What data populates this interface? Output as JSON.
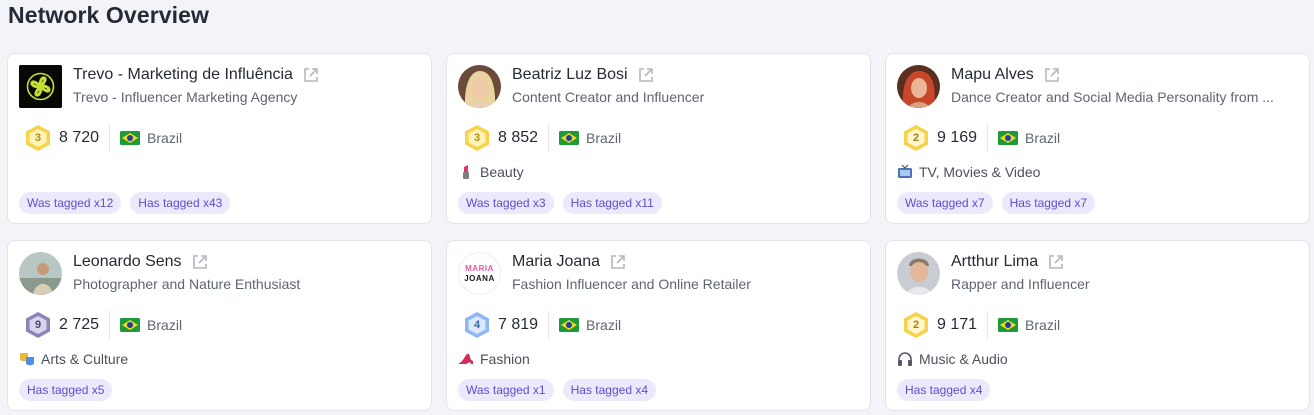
{
  "page": {
    "title": "Network Overview"
  },
  "cards": [
    {
      "name": "Trevo - Marketing de Influência",
      "subtitle": "Trevo - Influencer Marketing Agency",
      "level": "3",
      "followers": "8 720",
      "country": "Brazil",
      "category": "",
      "tags": [
        "Was tagged x12",
        "Has tagged x43"
      ]
    },
    {
      "name": "Beatriz Luz Bosi",
      "subtitle": "Content Creator and Influencer",
      "level": "3",
      "followers": "8 852",
      "country": "Brazil",
      "category": "Beauty",
      "tags": [
        "Was tagged x3",
        "Has tagged x11"
      ]
    },
    {
      "name": "Mapu Alves",
      "subtitle": "Dance Creator and Social Media Personality from ...",
      "level": "2",
      "followers": "9 169",
      "country": "Brazil",
      "category": "TV, Movies & Video",
      "tags": [
        "Was tagged x7",
        "Has tagged x7"
      ]
    },
    {
      "name": "Leonardo Sens",
      "subtitle": "Photographer and Nature Enthusiast",
      "level": "9",
      "followers": "2 725",
      "country": "Brazil",
      "category": "Arts & Culture",
      "tags": [
        "Has tagged x5"
      ]
    },
    {
      "name": "Maria Joana",
      "subtitle": "Fashion Influencer and Online Retailer",
      "level": "4",
      "followers": "7 819",
      "country": "Brazil",
      "category": "Fashion",
      "tags": [
        "Was tagged x1",
        "Has tagged x4"
      ]
    },
    {
      "name": "Artthur Lima",
      "subtitle": "Rapper and Influencer",
      "level": "2",
      "followers": "9 171",
      "country": "Brazil",
      "category": "Music & Audio",
      "tags": [
        "Has tagged x4"
      ]
    }
  ],
  "avatar_text": {
    "maria_joana_line1": "MARIA",
    "maria_joana_line2": "JOANA"
  },
  "icons": {
    "external_link": "external-link-icon",
    "flag": "brazil-flag-icon",
    "beauty": "lipstick-icon",
    "tv": "tv-icon",
    "arts": "theater-masks-icon",
    "fashion": "high-heel-icon",
    "music": "headphones-icon"
  },
  "colors": {
    "tag_bg": "#ece9fd",
    "tag_text": "#5a4fcf",
    "gold_badge": "#f6d34a",
    "blue_badge": "#8fb6f5",
    "purple_badge": "#8a86b8"
  }
}
